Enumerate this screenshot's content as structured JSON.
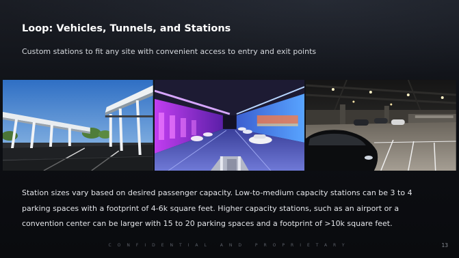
{
  "slide": {
    "title": "Loop: Vehicles, Tunnels, and Stations",
    "subtitle": "Custom stations to fit any site with convenient access to entry and exit points",
    "body_lines": [
      "Station sizes vary based on desired passenger capacity. Low-to-medium capacity stations can be 3 to 4",
      "parking spaces with a footprint of 4-6k square feet. Higher capacity stations, such as an airport or a",
      "convention center can be larger with 15 to 20 parking spaces and a footprint of >10k square feet."
    ],
    "footer": "CONFIDENTIAL AND PROPRIETARY",
    "page_number": "13"
  },
  "photos": [
    {
      "name": "outdoor-station-canopy-photo"
    },
    {
      "name": "tunnel-station-purple-lit-photo"
    },
    {
      "name": "indoor-garage-station-photo"
    }
  ]
}
